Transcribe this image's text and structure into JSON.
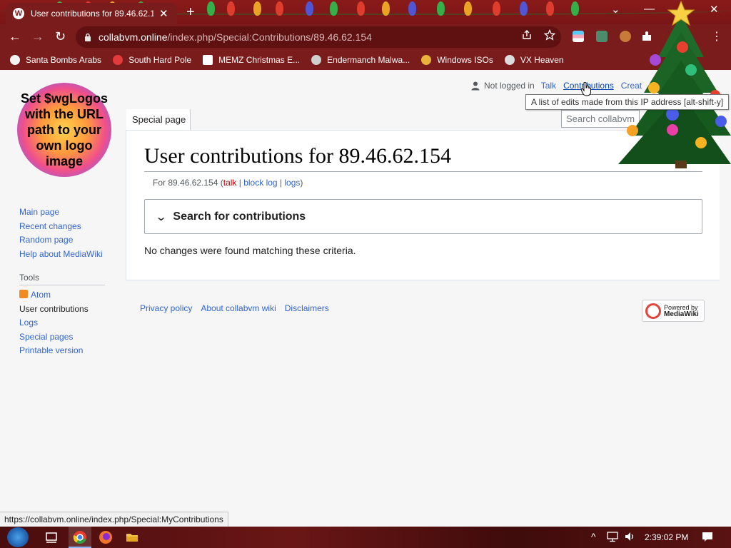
{
  "browser": {
    "tab_title": "User contributions for 89.46.62.1",
    "tab_favicon": "W",
    "url_host": "collabvm.online",
    "url_path": "/index.php/Special:Contributions/89.46.62.154",
    "new_tab": "+",
    "close_tab": "✕",
    "window": {
      "dropdown": "⌄",
      "minimize": "—",
      "restore": "❐",
      "close": "✕"
    },
    "nav": {
      "back": "←",
      "forward": "→",
      "reload": "↻"
    },
    "bookmarks": [
      {
        "label": "Santa Bombs Arabs",
        "icon": "santa-icon",
        "color": "#f3f3f3"
      },
      {
        "label": "South Hard Pole",
        "icon": "star-icon",
        "color": "#e23b3b"
      },
      {
        "label": "MEMZ Christmas E...",
        "icon": "memz-icon",
        "color": "#ffffff"
      },
      {
        "label": "Endermanch Malwa...",
        "icon": "endermanch-icon",
        "color": "#cfcfcf"
      },
      {
        "label": "Windows ISOs",
        "icon": "windows-isos-icon",
        "color": "#e8b43a"
      },
      {
        "label": "VX Heaven",
        "icon": "vx-heaven-icon",
        "color": "#dcdcdc"
      }
    ]
  },
  "wiki": {
    "logo_text": "Set $wgLogos with the URL path to your own logo image",
    "navigation": [
      "Main page",
      "Recent changes",
      "Random page",
      "Help about MediaWiki"
    ],
    "tools_heading": "Tools",
    "tools": {
      "atom": "Atom",
      "items": [
        "User contributions",
        "Logs",
        "Special pages",
        "Printable version"
      ]
    },
    "personal": {
      "not_logged_in": "Not logged in",
      "talk": "Talk",
      "contributions": "Contributions",
      "create": "Creat"
    },
    "tooltip": "A list of edits made from this IP address [alt-shift-y]",
    "tab_special": "Special page",
    "search_placeholder": "Search collabvm",
    "heading": "User contributions for 89.46.62.154",
    "subtitle": {
      "prefix": "For 89.46.62.154 (",
      "talk": "talk",
      "sep1": " | ",
      "block_log": "block log",
      "sep2": " | ",
      "logs": "logs",
      "suffix": ")"
    },
    "search_panel_label": "Search for contributions",
    "no_changes": "No changes were found matching these criteria.",
    "footer": [
      "Privacy policy",
      "About collabvm wiki",
      "Disclaimers"
    ],
    "powered_by": {
      "line1": "Powered by",
      "line2": "MediaWiki"
    }
  },
  "status_url": "https://collabvm.online/index.php/Special:MyContributions",
  "taskbar": {
    "clock": "2:39:02 PM",
    "tray": {
      "chevron": "^",
      "network": "🖧",
      "volume": "🔊",
      "notifications": "🗨"
    }
  },
  "colors": {
    "chrome": "#7b1c1c",
    "link": "#3366cc",
    "redlink": "#ba0000"
  }
}
